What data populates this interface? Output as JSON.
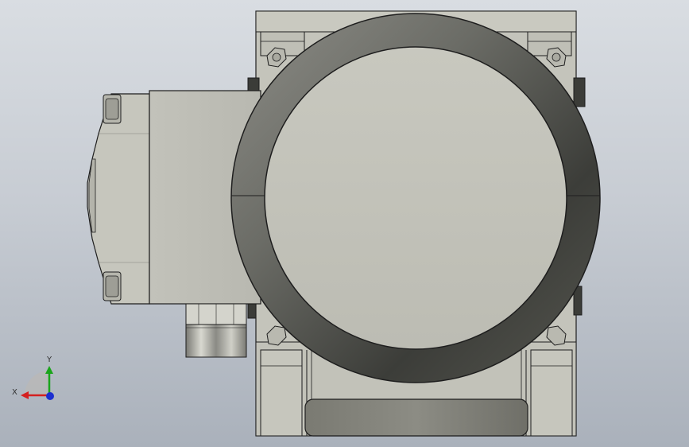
{
  "viewport": {
    "background_top": "#d9dde2",
    "background_bottom": "#aab1bb"
  },
  "model": {
    "part_color": "#c0c0b8",
    "ring_color": "#6e6f6a",
    "edge_color": "#1e1e1e"
  },
  "triad": {
    "x_label": "X",
    "y_label": "Y",
    "x_color": "#d42020",
    "y_color": "#1aa51a",
    "z_color": "#1c2fd0"
  }
}
